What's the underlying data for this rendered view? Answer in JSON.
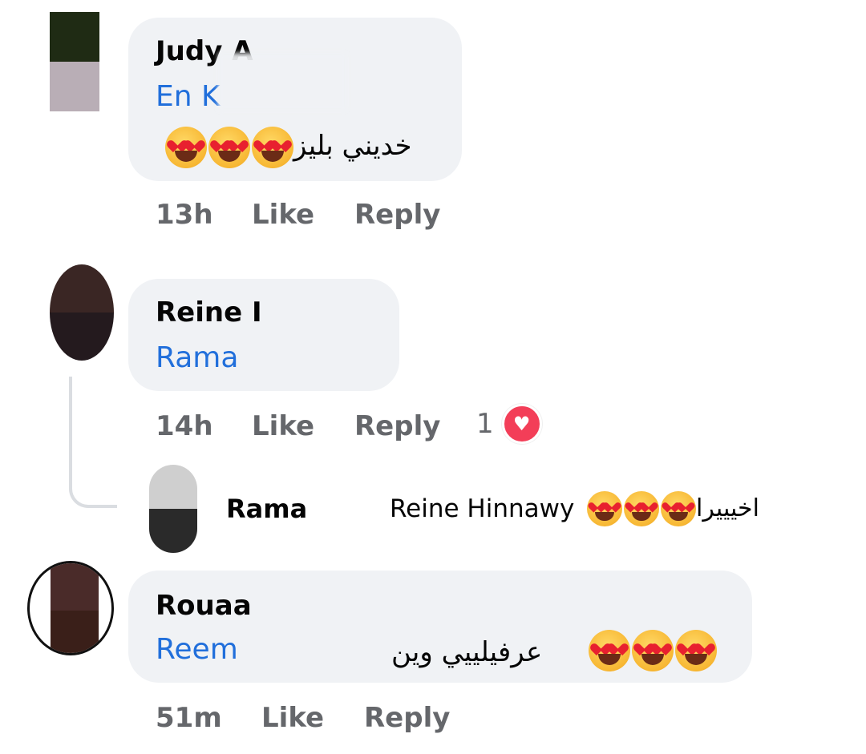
{
  "comments": [
    {
      "author": "Judy A",
      "mention": "En K",
      "text": "خديني بليز",
      "emoji_name": "heart-eyes-emoji",
      "emoji_count": 3,
      "time": "13h",
      "like_label": "Like",
      "reply_label": "Reply"
    },
    {
      "author": "Reine I",
      "mention": "Rama",
      "time": "14h",
      "like_label": "Like",
      "reply_label": "Reply",
      "reaction_count": "1",
      "reaction_icon": "heart-reaction-icon",
      "reply": {
        "author": "Rama",
        "mention": "Reine Hinnawy",
        "text": "اخيييرا",
        "emoji_name": "heart-eyes-emoji",
        "emoji_count": 3
      }
    },
    {
      "author": "Rouaa",
      "mention": "Reem",
      "text": "عرفيلييي وين",
      "emoji_name": "heart-eyes-emoji",
      "emoji_count": 3,
      "time": "51m",
      "like_label": "Like",
      "reply_label": "Reply"
    }
  ],
  "colors": {
    "bubble": "#f0f2f5",
    "mention": "#216fdb",
    "meta": "#65676b",
    "heart": "#f33e58"
  }
}
